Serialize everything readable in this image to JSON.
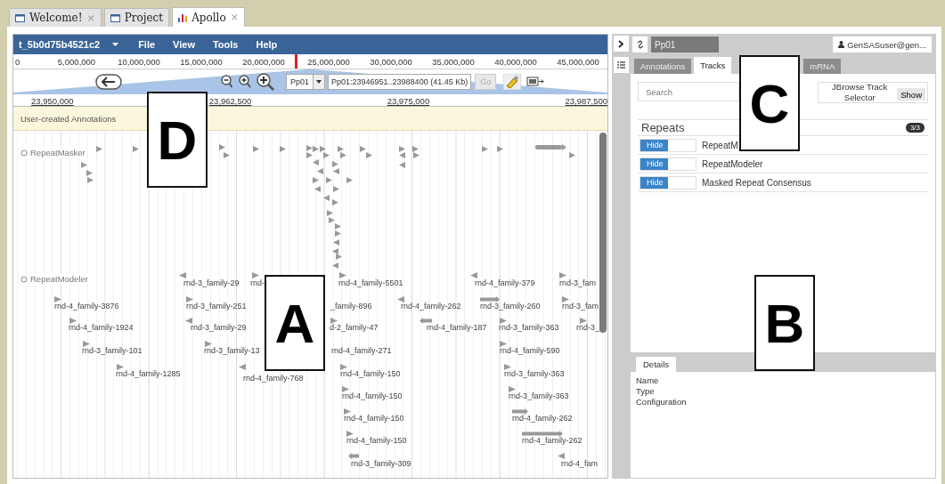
{
  "window_tabs": [
    {
      "label": "Welcome!",
      "kind": "page",
      "close": "×",
      "selected": false
    },
    {
      "label": "Project",
      "kind": "page",
      "selected": false
    },
    {
      "label": "Apollo",
      "kind": "chart",
      "close": "×",
      "selected": true
    }
  ],
  "browser": {
    "organism": "t_5b0d75b4521c2",
    "menu": [
      "File",
      "View",
      "Tools",
      "Help"
    ],
    "overview_ticks": [
      "0",
      "5,000,000",
      "10,000,000",
      "15,000,000",
      "20,000,000",
      "25,000,000",
      "30,000,000",
      "35,000,000",
      "40,000,000",
      "45,000,000"
    ],
    "sequence": "Pp01",
    "location": "Pp01:23946951..23988400 (41.45 Kb)",
    "go": {
      "label": "Go",
      "disabled": true
    },
    "detail_ticks": [
      "23,950,000",
      "23,962,500",
      "23,975,000",
      "23,987,500"
    ],
    "annotation_track": "User-created Annotations",
    "tracks": [
      {
        "label": "RepeatMasker"
      },
      {
        "label": "RepeatModeler"
      }
    ],
    "features": [
      {
        "label": "rnd-3_family-29",
        "kind": "arrow",
        "reverse": true
      },
      {
        "label": "rnd-",
        "kind": "arrow",
        "reverse": false
      },
      {
        "label": "rnd-4_family-5501",
        "kind": "arrow",
        "reverse": false
      },
      {
        "label": "rnd-4_family-379",
        "kind": "arrow",
        "reverse": true
      },
      {
        "label": "rnd-3_fam",
        "kind": "arrow",
        "reverse": false
      },
      {
        "label": "rnd-4_family-3876",
        "kind": "arrow",
        "reverse": false
      },
      {
        "label": "rnd-3_family-251",
        "kind": "arrow",
        "reverse": false
      },
      {
        "label": "_family-896",
        "kind": "label"
      },
      {
        "label": "rnd-4_family-262",
        "kind": "arrow",
        "reverse": true
      },
      {
        "label": "rnd-3_family-260",
        "kind": "bar",
        "reverse": false
      },
      {
        "label": "rnd-3_fam",
        "kind": "arrow",
        "reverse": false
      },
      {
        "label": "rnd-4_family-1924",
        "kind": "arrow",
        "reverse": false
      },
      {
        "label": "rnd-3_family-29",
        "kind": "arrow",
        "reverse": true
      },
      {
        "label": "d-2_family-47",
        "kind": "arrow",
        "reverse": false
      },
      {
        "label": "rnd-4_family-187",
        "kind": "bar",
        "reverse": true
      },
      {
        "label": "rnd-3_family-363",
        "kind": "arrow",
        "reverse": false
      },
      {
        "label": "rnd-3_",
        "kind": "arrow",
        "reverse": false
      },
      {
        "label": "rnd-3_family-101",
        "kind": "arrow",
        "reverse": false
      },
      {
        "label": "rnd-3_family-13",
        "kind": "arrow",
        "reverse": false
      },
      {
        "label": "rnd-4_family-271",
        "kind": "label"
      },
      {
        "label": "rnd-4_family-590",
        "kind": "arrow",
        "reverse": false
      },
      {
        "label": "rnd-4_family-1285",
        "kind": "arrow",
        "reverse": false
      },
      {
        "label": "rnd-4_family-768",
        "kind": "arrow",
        "reverse": true
      },
      {
        "label": "rnd-4_family-150",
        "kind": "arrow",
        "reverse": false
      },
      {
        "label": "rnd-3_family-363",
        "kind": "arrow",
        "reverse": false
      },
      {
        "label": "rnd-4_family-150",
        "kind": "arrow",
        "reverse": false
      },
      {
        "label": "rnd-3_family-363",
        "kind": "arrow",
        "reverse": false
      },
      {
        "label": "rnd-4_family-150",
        "kind": "arrow",
        "reverse": false
      },
      {
        "label": "rnd-4_family-262",
        "kind": "bar",
        "reverse": false
      },
      {
        "label": "rnd-4_family-150",
        "kind": "arrow",
        "reverse": false
      },
      {
        "label": "rnd-4_family-262",
        "kind": "bar",
        "reverse": false
      },
      {
        "label": "rnd-3_family-309",
        "kind": "bar",
        "reverse": true
      },
      {
        "label": "rnd-4_fam",
        "kind": "arrow",
        "reverse": true
      }
    ]
  },
  "side_panel": {
    "sequence": "Pp01",
    "user": "GenSASuser@gen...",
    "tabs": [
      {
        "label": "Annotations",
        "selected": false
      },
      {
        "label": "Tracks",
        "selected": true
      },
      {
        "label": "mRNA",
        "selected": false
      }
    ],
    "search": {
      "placeholder": "Search"
    },
    "track_selector": {
      "label": "JBrowse Track Selector",
      "button": "Show"
    },
    "category": {
      "name": "Repeats",
      "count": "3/3"
    },
    "track_rows": [
      {
        "button": "Hide",
        "name": "RepeatM"
      },
      {
        "button": "Hide",
        "name": "RepeatModeler"
      },
      {
        "button": "Hide",
        "name": "Masked Repeat Consensus"
      }
    ],
    "details": {
      "tab": "Details",
      "fields": [
        "Name",
        "Type",
        "Configuration"
      ]
    }
  },
  "callouts": [
    "D",
    "C",
    "A",
    "B"
  ]
}
